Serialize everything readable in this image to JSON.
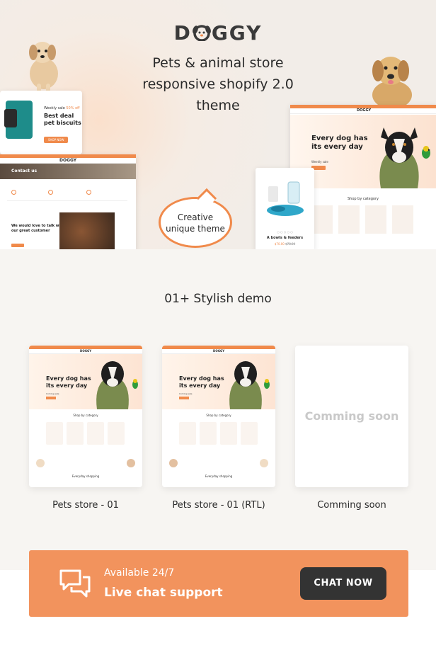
{
  "brand": {
    "name_pre": "D",
    "name_post": "GGY"
  },
  "tagline": {
    "line1": "Pets & animal store",
    "line2": "responsive shopify 2.0",
    "line3": "theme"
  },
  "hero_cards": {
    "promo_weekly": "Weekly sale",
    "promo_off": "50% off",
    "promo_title_1": "Best deal",
    "promo_title_2": "pet biscuits",
    "promo_button": "SHOP NOW",
    "contact_title": "Contact us",
    "contact_brand": "DOGGY",
    "contact_copy_1": "We would love to talk with",
    "contact_copy_2": "our great customer",
    "main_brand": "DOGGY",
    "main_head_1": "Every dog has",
    "main_head_2": "its every day",
    "main_weekly": "Weekly sale",
    "main_cat": "Shop by category",
    "product_name": "A bowls & feeders",
    "product_price": "$70.00",
    "product_old": "$78.00"
  },
  "bubble": {
    "line1": "Creative",
    "line2": "unique theme"
  },
  "demos": {
    "title": "01+ Stylish demo",
    "items": [
      {
        "label": "Pets store  - 01",
        "brand": "DOGGY",
        "head_1": "Every dog has",
        "head_2": "its every day",
        "weekly": "Coming sale",
        "cat": "Shop by category",
        "ev": "Everyday shopping"
      },
      {
        "label": "Pets store  - 01 (RTL)",
        "brand": "DOGGY",
        "head_1": "Every dog has",
        "head_2": "its every day",
        "weekly": "Coming sale",
        "cat": "Shop by category",
        "ev": "Everyday shopping"
      },
      {
        "label": "Comming soon",
        "soon": "Comming soon"
      }
    ]
  },
  "chat": {
    "subtitle": "Available 24/7",
    "title": "Live chat support",
    "button": "CHAT NOW"
  },
  "colors": {
    "accent": "#f08a4b",
    "chat_bg": "#f2935d",
    "button_dark": "#333333",
    "demo_bg": "#f7f5f2"
  },
  "icons": {
    "chat": "chat-bubbles-icon",
    "paw": "paw-icon"
  }
}
